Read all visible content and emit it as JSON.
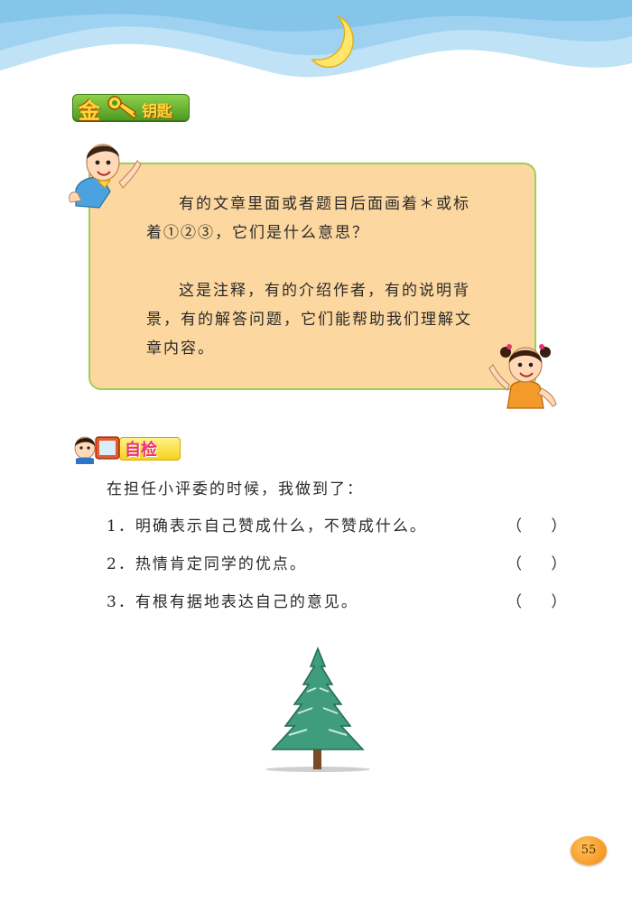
{
  "header": {
    "key_badge": {
      "gold_char": "金",
      "label": "钥匙"
    }
  },
  "tip": {
    "question": "有的文章里面或者题目后面画着＊或标着①②③，它们是什么意思？",
    "answer": "这是注释，有的介绍作者，有的说明背景，有的解答问题，它们能帮助我们理解文章内容。"
  },
  "self_check": {
    "badge_label": "自检",
    "intro": "在担任小评委的时候，我做到了：",
    "items": [
      {
        "text": "1．明确表示自己赞成什么，不赞成什么。",
        "paren": "（      ）"
      },
      {
        "text": "2．热情肯定同学的优点。",
        "paren": "（      ）"
      },
      {
        "text": "3．有根有据地表达自己的意见。",
        "paren": "（      ）"
      }
    ]
  },
  "footer": {
    "page_number": "55"
  },
  "colors": {
    "tip_box_fill": "#fcd79f",
    "tip_box_border": "#9ccf5a",
    "sky": "#bfe2f6",
    "badge_green": "#4e9b22",
    "check_pink": "#e8327a",
    "page_badge": "#f08a10"
  },
  "icons": [
    "moon-icon",
    "key-icon",
    "boy-illustration",
    "girl-illustration",
    "kid-with-card-icon",
    "pine-tree-illustration"
  ]
}
